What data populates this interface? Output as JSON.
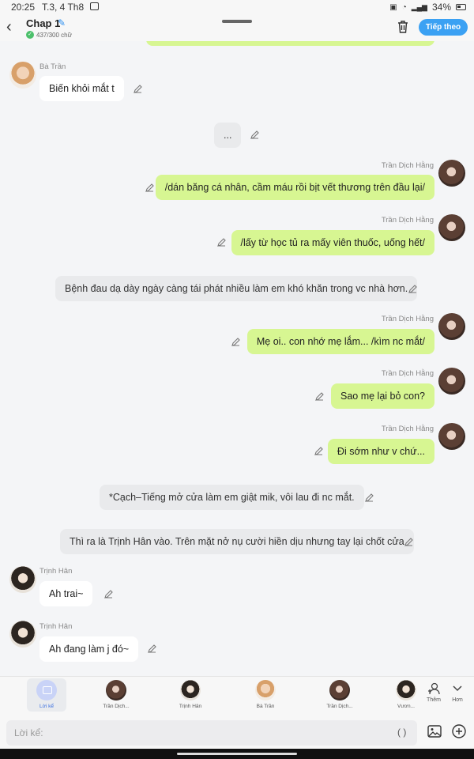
{
  "status": {
    "time": "20:25",
    "date": "T.3, 4 Th8",
    "battery": "34%"
  },
  "header": {
    "title": "Chap 1",
    "word_count": "437/300 chữ",
    "next_label": "Tiếp theo"
  },
  "messages": [
    {
      "kind": "left",
      "speaker": "Bà Trần",
      "text": "Biến khỏi mắt t"
    },
    {
      "kind": "narration",
      "text": "..."
    },
    {
      "kind": "right",
      "speaker": "Trần Dịch Hằng",
      "text": "/dán băng cá nhân, cầm máu rồi bịt vết thương trên đầu lại/"
    },
    {
      "kind": "right",
      "speaker": "Trần Dịch Hằng",
      "text": "/lấy từ học tủ ra mấy viên thuốc, uống hết/"
    },
    {
      "kind": "narration",
      "text": "Bệnh đau dạ dày ngày càng tái phát nhiều làm em khó khăn trong vc nhà hơn."
    },
    {
      "kind": "right",
      "speaker": "Trần Dịch Hằng",
      "text": "Mẹ oi.. con nhớ mẹ lắm... /kìm nc mắt/"
    },
    {
      "kind": "right",
      "speaker": "Trần Dịch Hằng",
      "text": "Sao mẹ lại bỏ con?"
    },
    {
      "kind": "right",
      "speaker": "Trần Dịch Hằng",
      "text": "Đi sớm như v chứ..."
    },
    {
      "kind": "narration",
      "text": "*Cạch–Tiếng mở cửa làm em giật mik, vôi lau đi nc mắt."
    },
    {
      "kind": "narration",
      "text": "Thì ra là Trịnh Hân vào. Trên mặt nở nụ cười hiền dịu nhưng tay lại chốt cửa"
    },
    {
      "kind": "left",
      "speaker": "Trịnh Hân",
      "text": "Ah trai~"
    },
    {
      "kind": "left",
      "speaker": "Trịnh Hân",
      "text": "Ah đang làm j đó~"
    }
  ],
  "characters": [
    {
      "label": "Lời kể"
    },
    {
      "label": "Trần Dịch..."
    },
    {
      "label": "Trịnh Hân"
    },
    {
      "label": "Bà Trần"
    },
    {
      "label": "Trần Dịch..."
    },
    {
      "label": "Vươn..."
    }
  ],
  "actions": {
    "add_label": "Thêm",
    "more_label": "Hơn"
  },
  "composer": {
    "placeholder": "Lời kể:",
    "paren": "( )"
  }
}
